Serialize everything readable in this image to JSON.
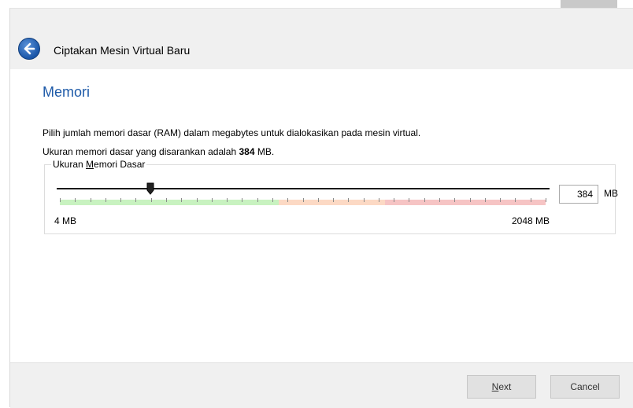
{
  "window": {
    "title": "Ciptakan Mesin Virtual Baru"
  },
  "page": {
    "heading": "Memori",
    "description_line1": "Pilih jumlah memori dasar (RAM) dalam megabytes untuk dialokasikan pada mesin virtual.",
    "description_line2_prefix": "Ukuran memori dasar yang disarankan adalah ",
    "description_line2_value": "384",
    "description_line2_suffix": " MB."
  },
  "memory": {
    "group_label_prefix": "Ukuran ",
    "group_label_mnemonic": "M",
    "group_label_suffix": "emori Dasar",
    "value": "384",
    "unit": "MB",
    "min_label": "4 MB",
    "max_label": "2048 MB",
    "min_mb": 4,
    "max_mb": 2048,
    "current_mb": 384
  },
  "buttons": {
    "next_mnemonic": "N",
    "next_rest": "ext",
    "cancel": "Cancel"
  },
  "colors": {
    "accent": "#1e5aa8",
    "scale_green": "#c8f2c0",
    "scale_orange": "#fcd9c4",
    "scale_red": "#f6c4c4"
  }
}
